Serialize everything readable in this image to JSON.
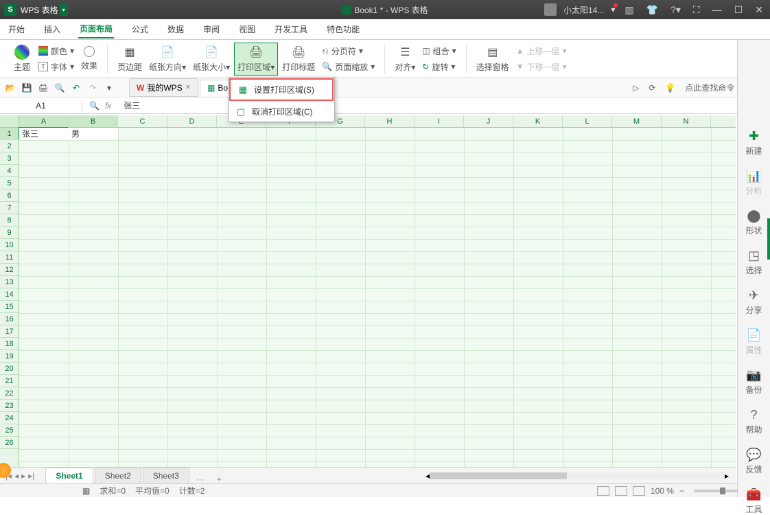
{
  "title": {
    "app": "WPS 表格",
    "doc": "Book1 * - WPS 表格",
    "user": "小太阳14..."
  },
  "menu": {
    "items": [
      "开始",
      "插入",
      "页面布局",
      "公式",
      "数据",
      "审阅",
      "视图",
      "开发工具",
      "特色功能"
    ],
    "active": 2
  },
  "ribbon": {
    "theme": "主题",
    "font": "字体",
    "color": "颜色",
    "effect": "效果",
    "margins": "页边距",
    "orient": "纸张方向",
    "size": "纸张大小",
    "printarea": "打印区域",
    "printtitle": "打印标题",
    "breaks": "分页符",
    "scale": "页面缩放",
    "align": "对齐",
    "rotate": "旋转",
    "group": "组合",
    "selpane": "选择窗格",
    "up": "上移一层",
    "down": "下移一层"
  },
  "dropdown": {
    "set": "设置打印区域(S)",
    "clear": "取消打印区域(C)"
  },
  "tabs": {
    "mywps": "我的WPS",
    "book": "Boo..."
  },
  "search": {
    "placeholder": "点此查找命令 (Alt+Q)"
  },
  "namebox": "A1",
  "fxcontent": "张三",
  "cols": [
    "A",
    "B",
    "C",
    "D",
    "E",
    "F",
    "G",
    "H",
    "I",
    "J",
    "K",
    "L",
    "M",
    "N"
  ],
  "rows": [
    1,
    2,
    3,
    4,
    5,
    6,
    7,
    8,
    9,
    10,
    11,
    12,
    13,
    14,
    15,
    16,
    17,
    18,
    19,
    20,
    21,
    22,
    23,
    24,
    25,
    26
  ],
  "cells": {
    "A1": "张三",
    "B1": "男"
  },
  "sheets": {
    "list": [
      "Sheet1",
      "Sheet2",
      "Sheet3"
    ],
    "active": 0,
    "more": "···",
    "add": "+"
  },
  "status": {
    "sum": "求和=0",
    "avg": "平均值=0",
    "count": "计数=2",
    "zoom": "100 %"
  },
  "side": {
    "new": "新建",
    "analyze": "分析",
    "shape": "形状",
    "select": "选择",
    "share": "分享",
    "prop": "属性",
    "backup": "备份",
    "help": "帮助",
    "feedback": "反馈",
    "tools": "工具"
  }
}
